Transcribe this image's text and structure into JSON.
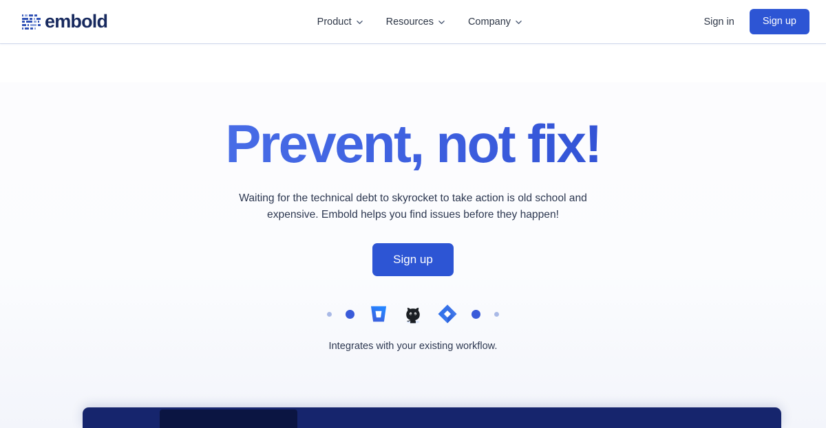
{
  "header": {
    "brand": {
      "name": "embold",
      "logo_icon": "embold-grid-logo-icon"
    },
    "nav": [
      {
        "label": "Product",
        "icon": "chevron-down-icon"
      },
      {
        "label": "Resources",
        "icon": "chevron-down-icon"
      },
      {
        "label": "Company",
        "icon": "chevron-down-icon"
      }
    ],
    "sign_in_label": "Sign in",
    "sign_up_label": "Sign up"
  },
  "hero": {
    "title": "Prevent, not fix!",
    "subtitle": "Waiting for the technical debt to skyrocket to take action is old school and expensive. Embold helps you find issues before they happen!",
    "cta_label": "Sign up",
    "integrations_caption": "Integrates with your existing workflow.",
    "integrations": [
      {
        "type": "dot",
        "size": "small",
        "name": "dot-small-left-outer",
        "color": "#a9b9e6"
      },
      {
        "type": "dot",
        "size": "medium",
        "name": "dot-medium-left",
        "color": "#3a5bd9"
      },
      {
        "type": "icon",
        "name": "bitbucket-icon",
        "label": "Bitbucket"
      },
      {
        "type": "icon",
        "name": "github-icon",
        "label": "GitHub"
      },
      {
        "type": "icon",
        "name": "jira-icon",
        "label": "Jira"
      },
      {
        "type": "dot",
        "size": "medium",
        "name": "dot-medium-right",
        "color": "#3a5bd9"
      },
      {
        "type": "dot",
        "size": "small",
        "name": "dot-small-right-outer",
        "color": "#a9b9e6"
      }
    ]
  },
  "colors": {
    "brand_navy": "#17295e",
    "accent_blue": "#2d55d4",
    "title_gradient_start": "#5379ec",
    "title_gradient_end": "#2a46c9",
    "panel_navy": "#16256d",
    "panel_navy_dark": "#0b1542",
    "body_text": "#2c3750",
    "hero_background": "#fcfcfe"
  }
}
